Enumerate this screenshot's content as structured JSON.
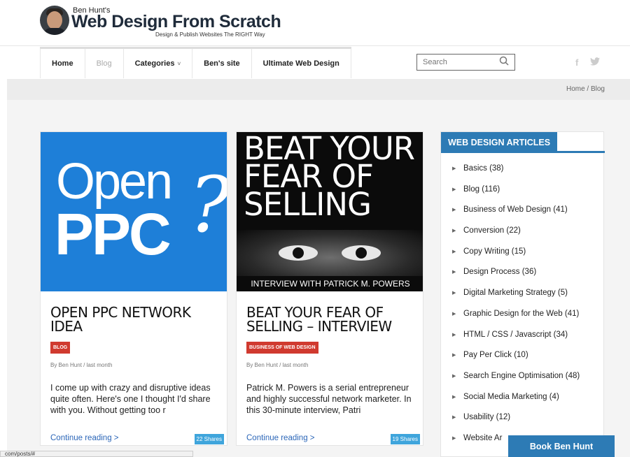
{
  "header": {
    "logo_top": "Ben Hunt's",
    "logo_main": "Web Design From Scratch",
    "logo_tagline": "Design & Publish Websites The RIGHT Way"
  },
  "nav": {
    "items": [
      {
        "label": "Home"
      },
      {
        "label": "Blog"
      },
      {
        "label": "Categories"
      },
      {
        "label": "Ben's site"
      },
      {
        "label": "Ultimate Web Design"
      }
    ],
    "search_placeholder": "Search",
    "social_fb": "f",
    "social_tw": "🐦"
  },
  "breadcrumb": "Home /  Blog",
  "posts": [
    {
      "image_line1": "Open",
      "image_line2": "PPC",
      "image_mark": "?",
      "title": "OPEN PPC NETWORK IDEA",
      "tag": "BLOG",
      "byline": "By Ben Hunt / last month",
      "excerpt": "I come up with crazy and disruptive ideas quite often. Here's one I thought I'd share with you. Without getting too r",
      "continue": "Continue reading >",
      "shares": "22 Shares"
    },
    {
      "image_headline": "BEAT YOUR FEAR OF SELLING",
      "image_caption": "INTERVIEW WITH PATRICK M. POWERS",
      "title": "BEAT YOUR FEAR OF SELLING – INTERVIEW",
      "tag": "BUSINESS OF WEB DESIGN",
      "byline": "By Ben Hunt / last month",
      "excerpt": "Patrick M. Powers is a serial entrepreneur and highly successful network marketer. In this 30-minute interview, Patri",
      "continue": "Continue reading >",
      "shares": "19 Shares"
    }
  ],
  "sidebar": {
    "title": "WEB DESIGN ARTICLES",
    "categories": [
      "Basics (38)",
      "Blog (116)",
      "Business of Web Design (41)",
      "Conversion (22)",
      "Copy Writing (15)",
      "Design Process (36)",
      "Digital Marketing Strategy (5)",
      "Graphic Design for the Web (41)",
      "HTML / CSS / Javascript (34)",
      "Pay Per Click (10)",
      "Search Engine Optimisation (48)",
      "Social Media Marketing (4)",
      "Usability (12)",
      "Website Ar"
    ]
  },
  "book_button": "Book Ben Hunt",
  "status_url": "com/posts/#"
}
